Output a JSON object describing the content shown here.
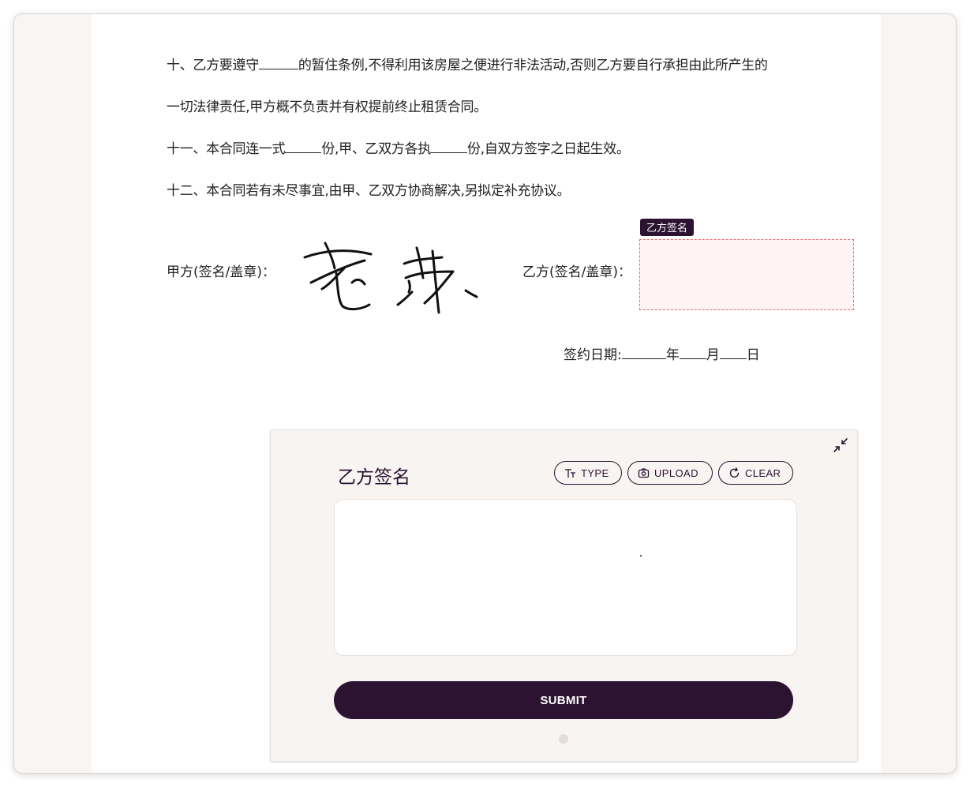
{
  "contract": {
    "clause10_part1": "十、乙方要遵守",
    "clause10_part2": "的暂住条例,不得利用该房屋之便进行非法活动,否则乙方要自行承担由此所产生的",
    "clause10_line2": "一切法律责任,甲方概不负责并有权提前终止租赁合同。",
    "clause11_part1": "十一、本合同连一式",
    "clause11_part2": "份,甲、乙双方各执",
    "clause11_part3": "份,自双方签字之日起生效。",
    "clause12": "十二、本合同若有未尽事宜,由甲、乙双方协商解决,另拟定补充协议。",
    "party_a_label": "甲方(签名/盖章)：",
    "party_b_label": "乙方(签名/盖章)：",
    "signature_field_tag": "乙方签名",
    "date_label": "签约日期:",
    "year": "年",
    "month": "月",
    "day": "日"
  },
  "signature_panel": {
    "title": "乙方签名",
    "type_label": "TYPE",
    "upload_label": "UPLOAD",
    "clear_label": "CLEAR",
    "submit_label": "SUBMIT"
  },
  "colors": {
    "brand": "#2b1331",
    "field_border": "#e66a6a",
    "field_fill": "#fff3f3"
  },
  "icons": [
    "type-icon",
    "camera-icon",
    "refresh-icon",
    "collapse-icon"
  ]
}
